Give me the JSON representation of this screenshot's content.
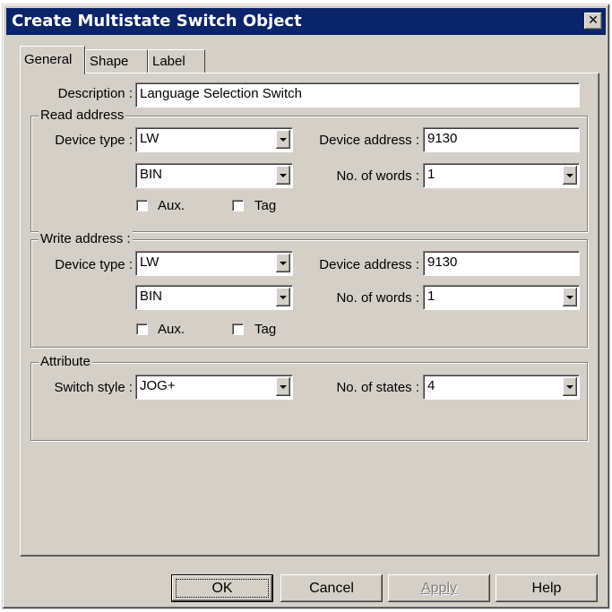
{
  "window": {
    "title": "Create Multistate Switch  Object",
    "close_label": "✕"
  },
  "tabs": [
    {
      "label": "General"
    },
    {
      "label": "Shape"
    },
    {
      "label": "Label"
    }
  ],
  "description": {
    "label": "Description :",
    "value": "Language Selection Switch"
  },
  "read_address": {
    "legend": "Read address",
    "device_type_label": "Device type :",
    "device_type_value": "LW",
    "device_address_label": "Device address :",
    "device_address_value": "9130",
    "format_value": "BIN",
    "no_of_words_label": "No. of words :",
    "no_of_words_value": "1",
    "aux_label": "Aux.",
    "tag_label": "Tag"
  },
  "write_address": {
    "legend": "Write address :",
    "device_type_label": "Device type :",
    "device_type_value": "LW",
    "device_address_label": "Device  address :",
    "device_address_value": "9130",
    "format_value": "BIN",
    "no_of_words_label": "No. of words :",
    "no_of_words_value": "1",
    "aux_label": "Aux.",
    "tag_label": "Tag"
  },
  "attribute": {
    "legend": "Attribute",
    "switch_style_label": "Switch style :",
    "switch_style_value": "JOG+",
    "no_of_states_label": "No. of states :",
    "no_of_states_value": "4"
  },
  "buttons": {
    "ok": "OK",
    "cancel": "Cancel",
    "apply": "Apply",
    "help": "Help"
  }
}
